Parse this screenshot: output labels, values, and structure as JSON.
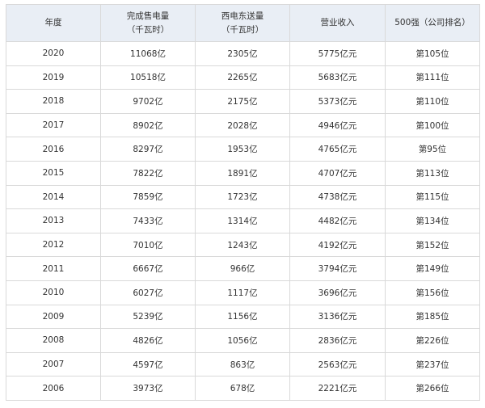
{
  "table": {
    "headers": [
      {
        "line1": "年度",
        "line2": ""
      },
      {
        "line1": "完成售电量",
        "line2": "（千瓦时）"
      },
      {
        "line1": "西电东送量",
        "line2": "（千瓦时）"
      },
      {
        "line1": "营业收入",
        "line2": ""
      },
      {
        "line1": "500强（公司排名）",
        "line2": ""
      }
    ],
    "rows": [
      [
        "2020",
        "11068亿",
        "2305亿",
        "5775亿元",
        "第105位"
      ],
      [
        "2019",
        "10518亿",
        "2265亿",
        "5683亿元",
        "第111位"
      ],
      [
        "2018",
        "9702亿",
        "2175亿",
        "5373亿元",
        "第110位"
      ],
      [
        "2017",
        "8902亿",
        "2028亿",
        "4946亿元",
        "第100位"
      ],
      [
        "2016",
        "8297亿",
        "1953亿",
        "4765亿元",
        "第95位"
      ],
      [
        "2015",
        "7822亿",
        "1891亿",
        "4707亿元",
        "第113位"
      ],
      [
        "2014",
        "7859亿",
        "1723亿",
        "4738亿元",
        "第115位"
      ],
      [
        "2013",
        "7433亿",
        "1314亿",
        "4482亿元",
        "第134位"
      ],
      [
        "2012",
        "7010亿",
        "1243亿",
        "4192亿元",
        "第152位"
      ],
      [
        "2011",
        "6667亿",
        "966亿",
        "3794亿元",
        "第149位"
      ],
      [
        "2010",
        "6027亿",
        "1117亿",
        "3696亿元",
        "第156位"
      ],
      [
        "2009",
        "5239亿",
        "1156亿",
        "3136亿元",
        "第185位"
      ],
      [
        "2008",
        "4826亿",
        "1056亿",
        "2836亿元",
        "第226位"
      ],
      [
        "2007",
        "4597亿",
        "863亿",
        "2563亿元",
        "第237位"
      ],
      [
        "2006",
        "3973亿",
        "678亿",
        "2221亿元",
        "第266位"
      ]
    ]
  }
}
